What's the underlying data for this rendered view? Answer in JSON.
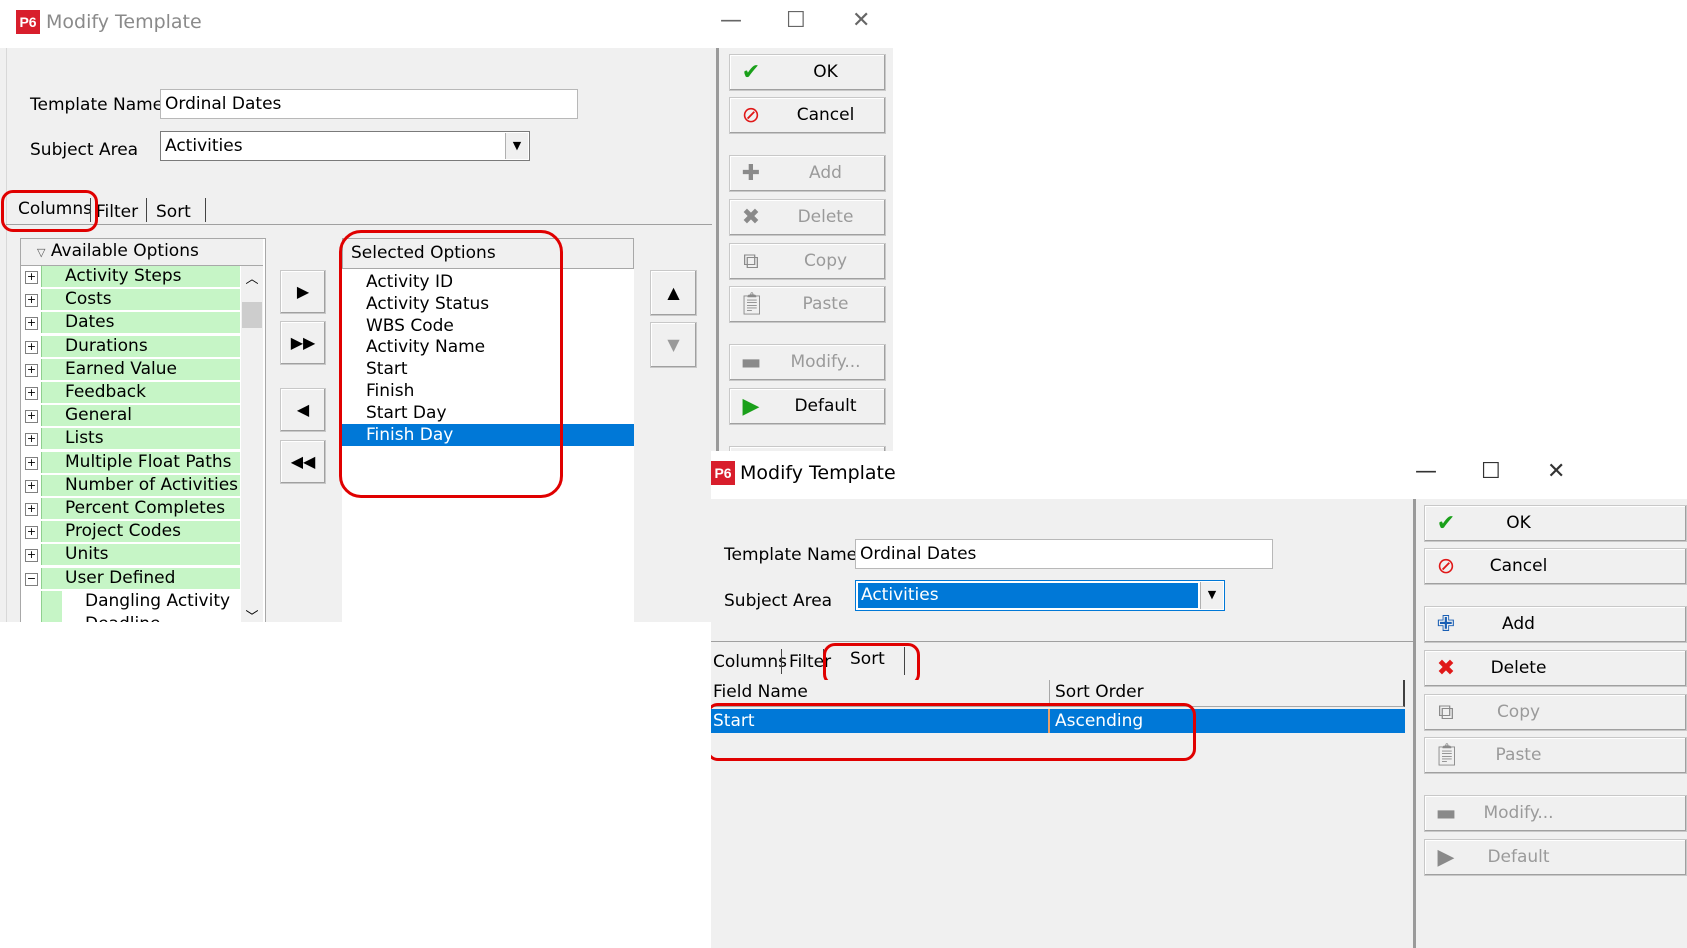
{
  "window1": {
    "logo": "P6",
    "title": "Modify Template",
    "controls": {
      "minimize": "—",
      "maximize": "☐",
      "close": "✕"
    },
    "template_name_label": "Template Name",
    "template_name_value": "Ordinal Dates",
    "subject_area_label": "Subject Area",
    "subject_area_value": "Activities",
    "tabs": [
      "Columns",
      "Filter",
      "Sort"
    ],
    "available_header": "Available Options",
    "available": [
      {
        "label": "Activity Steps",
        "toggle": "+"
      },
      {
        "label": "Costs",
        "toggle": "+"
      },
      {
        "label": "Dates",
        "toggle": "+"
      },
      {
        "label": "Durations",
        "toggle": "+"
      },
      {
        "label": "Earned Value",
        "toggle": "+"
      },
      {
        "label": "Feedback",
        "toggle": "+"
      },
      {
        "label": "General",
        "toggle": "+"
      },
      {
        "label": "Lists",
        "toggle": "+"
      },
      {
        "label": "Multiple Float Paths",
        "toggle": "+"
      },
      {
        "label": "Number of Activities",
        "toggle": "+"
      },
      {
        "label": "Percent Completes",
        "toggle": "+"
      },
      {
        "label": "Project Codes",
        "toggle": "+"
      },
      {
        "label": "Units",
        "toggle": "+"
      },
      {
        "label": "User Defined",
        "toggle": "−"
      }
    ],
    "available_children": [
      "Dangling Activity",
      "Deadline"
    ],
    "selected_header": "Selected Options",
    "selected": [
      "Activity ID",
      "Activity Status",
      "WBS Code",
      "Activity Name",
      "Start",
      "Finish",
      "Start Day",
      "Finish Day"
    ],
    "selected_highlighted": "Finish Day",
    "buttons": {
      "ok": "OK",
      "cancel": "Cancel",
      "add": "Add",
      "delete": "Delete",
      "copy": "Copy",
      "paste": "Paste",
      "modify": "Modify...",
      "default": "Default"
    }
  },
  "window2": {
    "logo": "P6",
    "title": "Modify Template",
    "controls": {
      "minimize": "—",
      "maximize": "☐",
      "close": "✕"
    },
    "template_name_label": "Template Name",
    "template_name_value": "Ordinal Dates",
    "subject_area_label": "Subject Area",
    "subject_area_value": "Activities",
    "tabs": [
      "Columns",
      "Filter",
      "Sort"
    ],
    "grid_headers": [
      "Field Name",
      "Sort Order"
    ],
    "grid_rows": [
      {
        "field": "Start",
        "order": "Ascending"
      }
    ],
    "buttons": {
      "ok": "OK",
      "cancel": "Cancel",
      "add": "Add",
      "delete": "Delete",
      "copy": "Copy",
      "paste": "Paste",
      "modify": "Modify...",
      "default": "Default"
    }
  },
  "colors": {
    "highlight": "#0078d7",
    "annotation_red": "#e00000",
    "tree_green": "#c6f5c6",
    "logo_red": "#d81e2c"
  }
}
